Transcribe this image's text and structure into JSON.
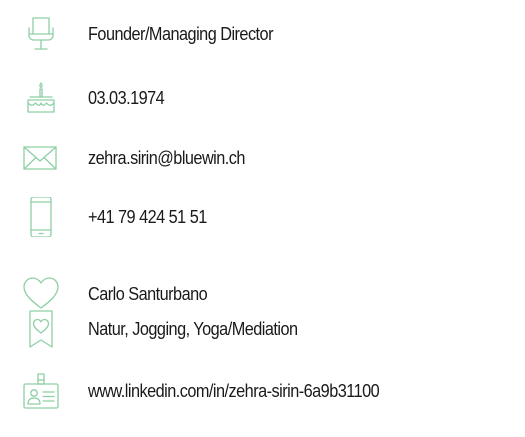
{
  "profile": {
    "accent_color": "#8ecfa5",
    "rows": [
      {
        "icon": "chair-icon",
        "text": "Founder/Managing Director"
      },
      {
        "icon": "birthday-cake-icon",
        "text": "03.03.1974"
      },
      {
        "icon": "mail-icon",
        "text": "zehra.sirin@bluewin.ch"
      },
      {
        "icon": "mobile-phone-icon",
        "text": "+41 79 424 51 51"
      },
      {
        "icon": "heart-icon",
        "text": "Carlo Santurbano"
      },
      {
        "icon": "bookmark-heart-icon",
        "text": "Natur, Jogging, Yoga/Mediation"
      },
      {
        "icon": "id-card-icon",
        "text": "www.linkedin.com/in/zehra-sirin-6a9b31100"
      }
    ]
  }
}
